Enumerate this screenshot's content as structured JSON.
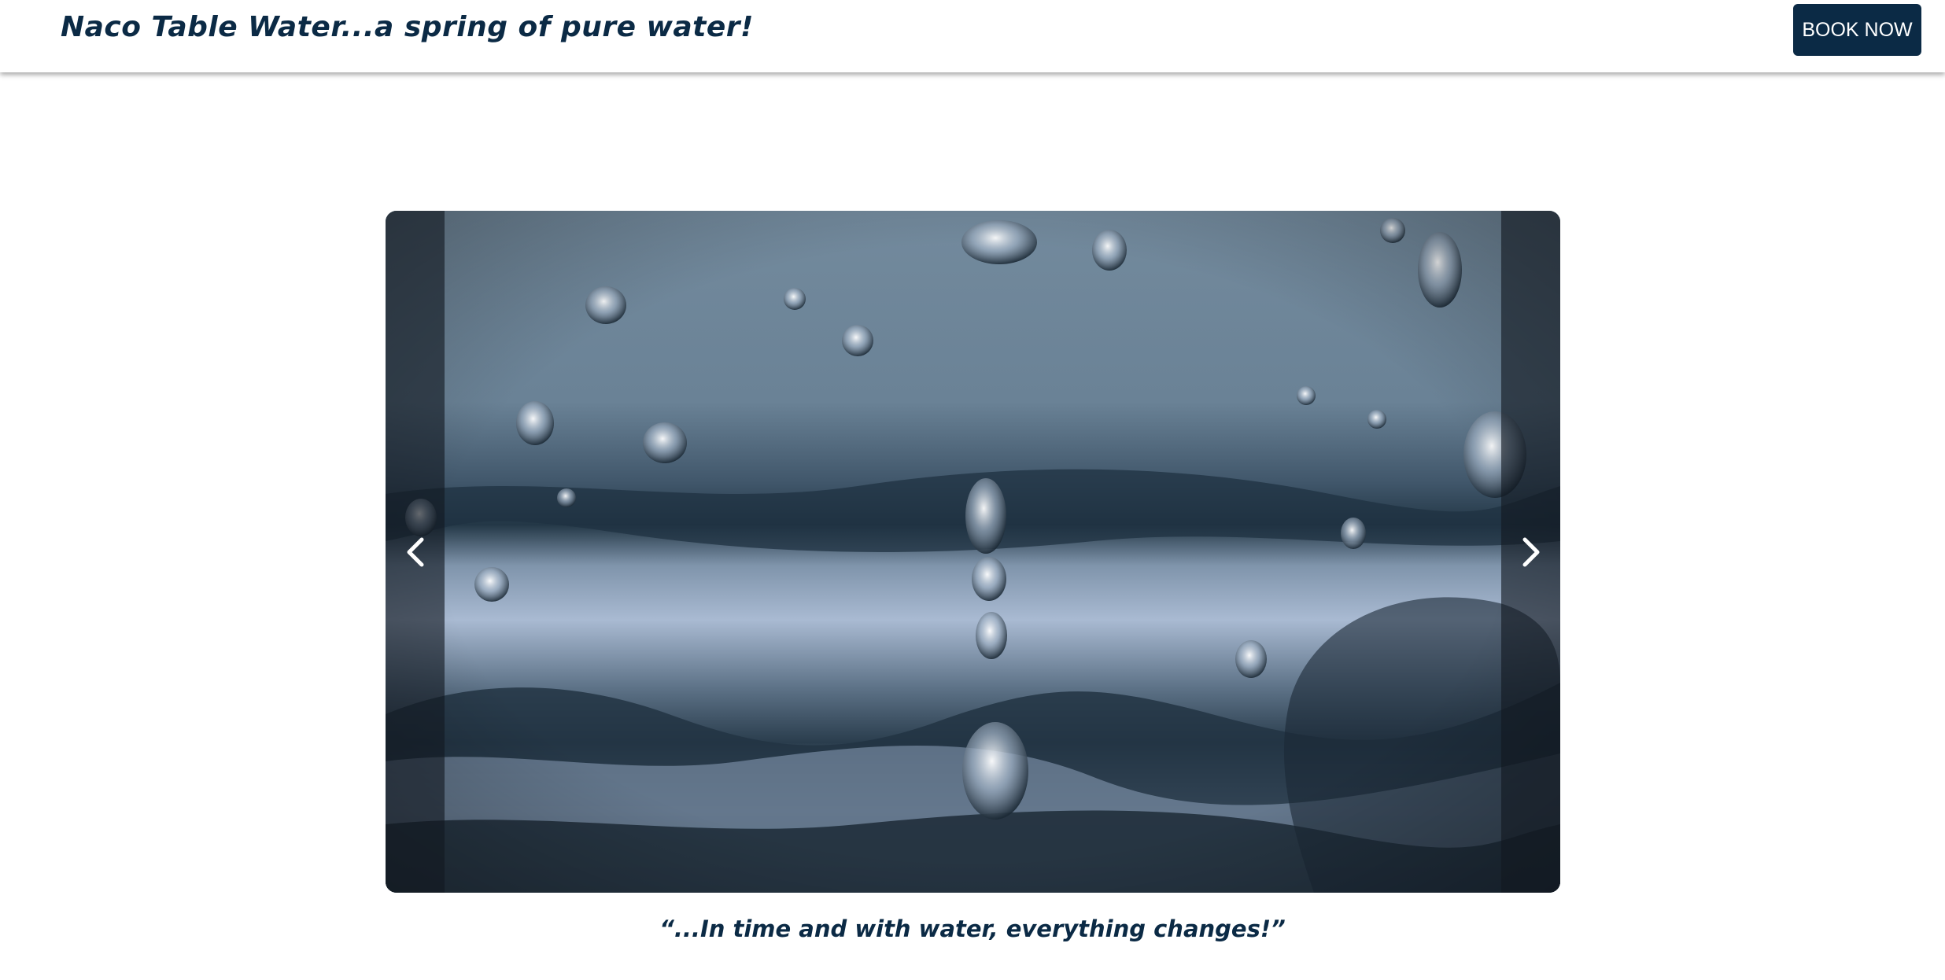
{
  "header": {
    "brand_text": "Naco Table Water...a spring of pure water!",
    "book_button_label": "BOOK NOW"
  },
  "carousel": {
    "image_alt": "water-drop-splash-photo",
    "prev_icon": "chevron-left-icon",
    "next_icon": "chevron-right-icon"
  },
  "quote": {
    "text": "“...In time and with water, everything changes!”"
  },
  "colors": {
    "brand_navy": "#0b2a45",
    "background": "#ffffff",
    "nav_overlay": "#12182099"
  }
}
